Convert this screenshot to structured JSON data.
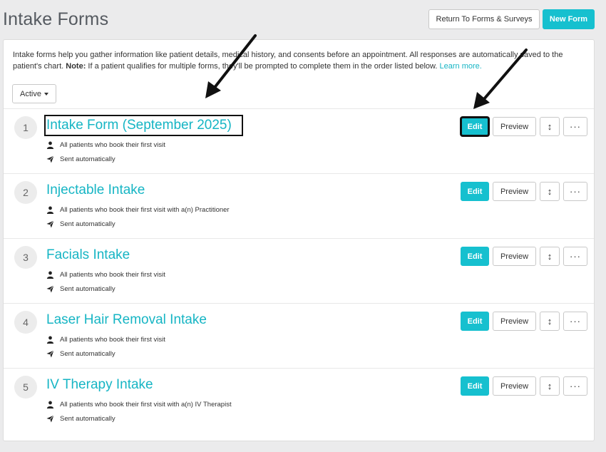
{
  "header": {
    "title": "Intake Forms",
    "return_label": "Return To Forms & Surveys",
    "new_label": "New Form"
  },
  "intro": {
    "text_before": "Intake forms help you gather information like patient details, medical history, and consents before an appointment. All responses are automatically saved to the patient's chart. ",
    "note_label": "Note:",
    "note_text": " If a patient qualifies for multiple forms, they'll be prompted to complete them in the order listed below. ",
    "learn_more": "Learn more."
  },
  "filter": {
    "selected": "Active"
  },
  "row_actions": {
    "edit": "Edit",
    "preview": "Preview",
    "reorder_glyph": "↕",
    "more_glyph": "···"
  },
  "forms": [
    {
      "number": "1",
      "title": "Intake Form (September 2025)",
      "audience": "All patients who book their first visit",
      "delivery": "Sent automatically"
    },
    {
      "number": "2",
      "title": "Injectable Intake",
      "audience": "All patients who book their first visit with a(n) Practitioner",
      "delivery": "Sent automatically"
    },
    {
      "number": "3",
      "title": "Facials Intake",
      "audience": "All patients who book their first visit",
      "delivery": "Sent automatically"
    },
    {
      "number": "4",
      "title": "Laser Hair Removal Intake",
      "audience": "All patients who book their first visit",
      "delivery": "Sent automatically"
    },
    {
      "number": "5",
      "title": "IV Therapy Intake",
      "audience": "All patients who book their first visit with a(n) IV Therapist",
      "delivery": "Sent automatically"
    }
  ],
  "icons": {
    "audience": "person-icon",
    "delivery": "paper-plane-icon",
    "reorder": "reorder-arrows-icon",
    "more": "more-options-icon"
  },
  "colors": {
    "accent": "#16c0cf",
    "link": "#16b5c4",
    "background": "#ebebec"
  }
}
